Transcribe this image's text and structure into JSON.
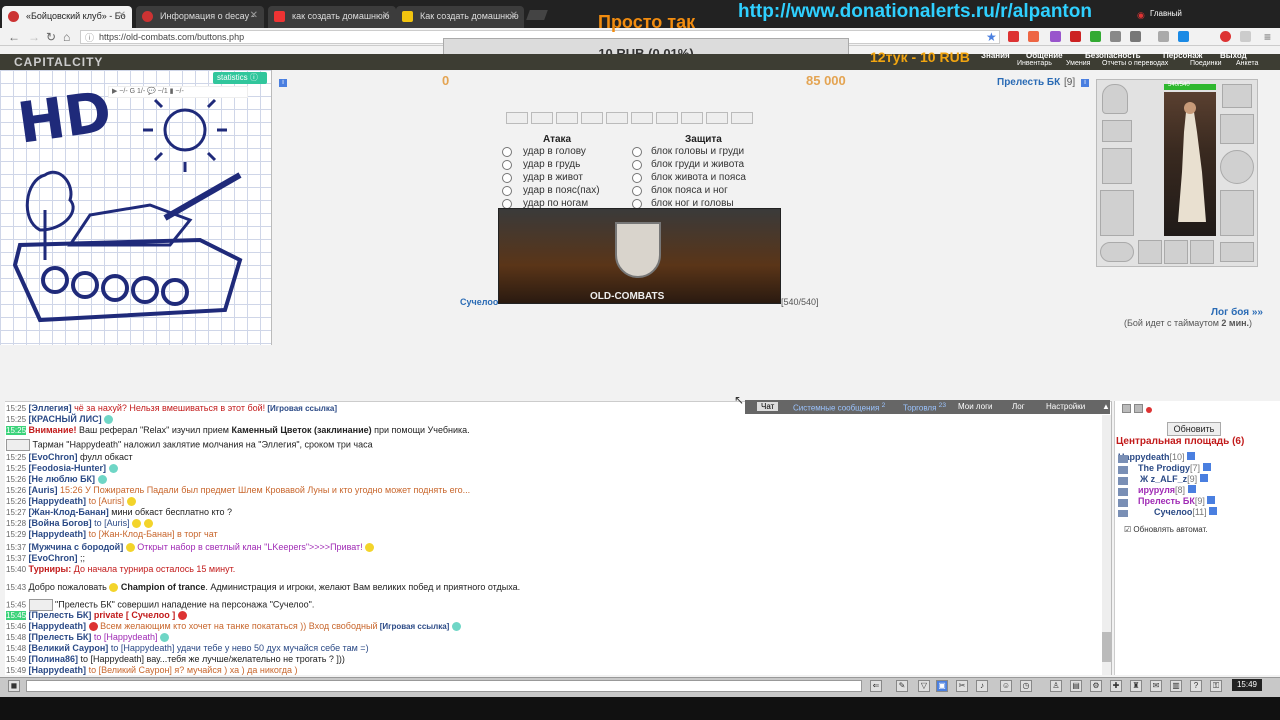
{
  "browser": {
    "tabs": [
      {
        "label": "«Бойцовский клуб» - Бо",
        "active": true
      },
      {
        "label": "Информация о decay -",
        "active": false
      },
      {
        "label": "как создать домашнюю",
        "active": false
      },
      {
        "label": "Как создать домашнюю",
        "active": false
      }
    ],
    "url": "https://old-combats.com/buttons.php",
    "window_label": "Главный"
  },
  "overlay": {
    "title": "Просто так",
    "donation_url": "http://www.donationalerts.ru/r/alpanton",
    "donation_amount": "10 RUB (0.01%)",
    "donor": "12тук - 10 RUB"
  },
  "game": {
    "city": "CAPITALCITY",
    "menu_top": [
      "Знания",
      "Общение",
      "Безопасность",
      "Персонаж",
      "Выход"
    ],
    "menu_bottom": [
      "Инвентарь",
      "Умения",
      "Отчеты о переводах",
      "Поединки",
      "Анкета"
    ],
    "statistics_label": "statistics",
    "stats_row": "▶ ~/-   G 1/-   💬 ~/1   ▮ ~/-",
    "score_left": "0",
    "score_right": "85 000",
    "attack_title": "Атака",
    "defense_title": "Защита",
    "attacks": [
      "удар в голову",
      "удар в грудь",
      "удар в живот",
      "удар в пояс(пах)",
      "удар по ногам"
    ],
    "defenses": [
      "блок головы и груди",
      "блок груди и живота",
      "блок живота и пояса",
      "блок пояса и ног",
      "блок ног и головы"
    ],
    "banner_title": "OLD-COMBATS",
    "opponent_short": "Сучелоо",
    "opponent_hp": "[540/540]",
    "char_name": "Прелесть БК",
    "char_level": "[9]",
    "char_hp": "540/540",
    "battle_log": "Лог боя »»",
    "battle_timer_prefix": "(Бой идет с таймаутом ",
    "battle_timer_value": "2 мин.",
    "battle_timer_suffix": ")"
  },
  "chat": {
    "tabs": [
      "Чат",
      "Системные сообщения",
      "Торговля",
      "Мои логи",
      "Лог",
      "Настройки"
    ],
    "tab_counts": [
      "",
      "2",
      "23",
      "",
      "",
      ""
    ],
    "lines": [
      {
        "time": "15:25",
        "nick": "[Эллегия]",
        "text": " чё за нахуй? Нельзя вмешиваться в этот бой!",
        "extra": " [Игровая ссылка]"
      },
      {
        "time": "15:25",
        "nick": "[КРАСНЫЙ ЛИС]",
        "text": "",
        "extra": ""
      },
      {
        "time": "15:25",
        "nick": "Внимание!",
        "text": " Ваш реферал \"Relax\" изучил прием ",
        "extra": "Каменный Цветок (заклинание)",
        "tail": " при помощи Учебника."
      },
      {
        "time": "",
        "nick": "",
        "text": " Тарман \"Happydeath\" наложил заклятие молчания на \"Эллегия\", сроком три часа",
        "extra": ""
      },
      {
        "time": "15:25",
        "nick": "[EvoChron]",
        "text": " фулл обкаст",
        "extra": ""
      },
      {
        "time": "15:25",
        "nick": "[Feodosia-Hunter]",
        "text": "",
        "extra": ""
      },
      {
        "time": "15:26",
        "nick": "[Не люблю БК]",
        "text": "",
        "extra": ""
      },
      {
        "time": "15:26",
        "nick": "[Auris]",
        "text": " 15:26 У Пожиратель Падали был предмет Шлем Кровавой Луны и кто угодно может поднять его...",
        "extra": ""
      },
      {
        "time": "15:26",
        "nick": "[Happydeath]",
        "text": " to [Auris]",
        "extra": ""
      },
      {
        "time": "15:27",
        "nick": "[Жан-Клод-Банан]",
        "text": " мини обкаст бесплатно кто ?",
        "extra": ""
      },
      {
        "time": "15:28",
        "nick": "[Война Богов]",
        "text": " to [Auris]",
        "extra": ""
      },
      {
        "time": "15:29",
        "nick": "[Happydeath]",
        "text": " to [Жан-Клод-Банан] в торг чат",
        "extra": ""
      },
      {
        "time": "15:37",
        "nick": "[Мужчина с бородой]",
        "text": " Открыт набор в светлый клан \"LKeepers\">>>>Приват!",
        "extra": ""
      },
      {
        "time": "15:37",
        "nick": "[EvoChron]",
        "text": " ;;",
        "extra": ""
      },
      {
        "time": "15:40",
        "nick": "Турниры:",
        "text": " До начала турнира осталось 15 минут.",
        "extra": ""
      },
      {
        "time": "15:43",
        "nick": "Добро пожаловать",
        "text": " Champion of trance",
        "extra": ". Администрация и игроки, желают Вам великих побед и приятного отдыха."
      },
      {
        "time": "15:45",
        "nick": "",
        "text": " \"Прелесть БК\" совершил нападение на персонажа \"Сучелоо\".",
        "extra": ""
      },
      {
        "time": "15:45",
        "nick": "[Прелесть БК]",
        "text": " private [ Сучелоо ]",
        "extra": ""
      },
      {
        "time": "15:46",
        "nick": "[Happydeath]",
        "text": " Всем желающим кто хочет на танке покататься )) Вход свободный",
        "extra": " [Игровая ссылка]"
      },
      {
        "time": "15:48",
        "nick": "[Прелесть БК]",
        "text": " to [Happydeath]",
        "extra": ""
      },
      {
        "time": "15:48",
        "nick": "[Великий Саурон]",
        "text": " to [Happydeath] удачи тебе у нево 50 дух мучайся себе там =)",
        "extra": ""
      },
      {
        "time": "15:49",
        "nick": "[Полина86]",
        "text": " to [Happydeath] вау...тебя же лучше/желательно не трогать ? ]))",
        "extra": ""
      },
      {
        "time": "15:49",
        "nick": "[Happydeath]",
        "text": " to [Великий Саурон] я? мучайся ) ха ) да никогда )",
        "extra": ""
      }
    ]
  },
  "online": {
    "refresh_label": "Обновить",
    "title": "Центральная площадь (6)",
    "users": [
      {
        "name": "Happydeath",
        "level": "[10]"
      },
      {
        "name": "The Prodigy",
        "level": "[7]"
      },
      {
        "name": "Ж z_ALF_z",
        "level": "[9]"
      },
      {
        "name": "ируруля",
        "level": "[8]"
      },
      {
        "name": "Прелесть БК",
        "level": "[9]"
      },
      {
        "name": "Сучелоо",
        "level": "[11]"
      }
    ],
    "auto_refresh": "Обновлять автомат."
  },
  "bottom": {
    "clock": "15:49"
  },
  "colors": {
    "accent_orange": "#f28c0f",
    "link_blue": "#2a6bb5",
    "system_red": "#c21b1b",
    "overlay_cyan": "#2fd0ff"
  }
}
